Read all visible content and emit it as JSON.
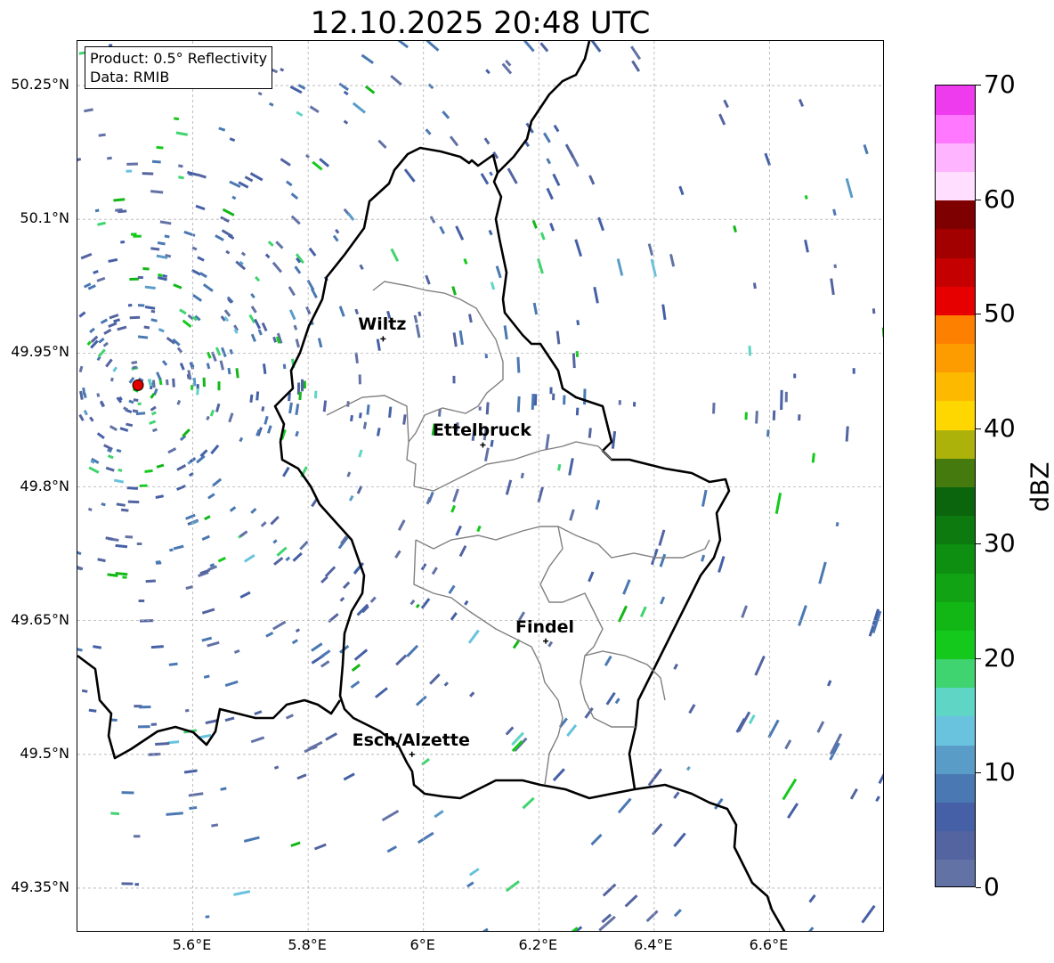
{
  "title": "12.10.2025 20:48 UTC",
  "info": {
    "product": "Product: 0.5° Reflectivity",
    "source": "Data: RMIB"
  },
  "map": {
    "lon_range": [
      5.4,
      6.8
    ],
    "lat_range": [
      49.3,
      50.3
    ],
    "lat_ticks": [
      {
        "value": 50.25,
        "label": "50.25°N"
      },
      {
        "value": 50.1,
        "label": "50.1°N"
      },
      {
        "value": 49.95,
        "label": "49.95°N"
      },
      {
        "value": 49.8,
        "label": "49.8°N"
      },
      {
        "value": 49.65,
        "label": "49.65°N"
      },
      {
        "value": 49.5,
        "label": "49.5°N"
      },
      {
        "value": 49.35,
        "label": "49.35°N"
      }
    ],
    "lon_ticks": [
      {
        "value": 5.6,
        "label": "5.6°E"
      },
      {
        "value": 5.8,
        "label": "5.8°E"
      },
      {
        "value": 6.0,
        "label": "6°E"
      },
      {
        "value": 6.2,
        "label": "6.2°E"
      },
      {
        "value": 6.4,
        "label": "6.4°E"
      },
      {
        "value": 6.6,
        "label": "6.6°E"
      }
    ],
    "radar_site": {
      "lon": 5.505,
      "lat": 49.914
    },
    "cities": [
      {
        "name": "Wiltz",
        "lon": 5.93,
        "lat": 49.966
      },
      {
        "name": "Ettelbruck",
        "lon": 6.103,
        "lat": 49.847
      },
      {
        "name": "Findel",
        "lon": 6.212,
        "lat": 49.627
      },
      {
        "name": "Esch/Alzette",
        "lon": 5.98,
        "lat": 49.5
      }
    ],
    "gridlines": true
  },
  "colorbar": {
    "unit": "dBZ",
    "min": 0,
    "max": 70,
    "step": 2.5,
    "ticks": [
      {
        "value": 0,
        "label": "0"
      },
      {
        "value": 10,
        "label": "10"
      },
      {
        "value": 20,
        "label": "20"
      },
      {
        "value": 30,
        "label": "30"
      },
      {
        "value": 40,
        "label": "40"
      },
      {
        "value": 50,
        "label": "50"
      },
      {
        "value": 60,
        "label": "60"
      },
      {
        "value": 70,
        "label": "70"
      }
    ],
    "colors": [
      "#6272a5",
      "#5364a0",
      "#4560a6",
      "#4a78b2",
      "#5a9cc8",
      "#69c2de",
      "#5ed5c5",
      "#3fd46f",
      "#14c91c",
      "#12b716",
      "#11a313",
      "#0f8f11",
      "#0d7a0f",
      "#0b650c",
      "#457a0e",
      "#adb20b",
      "#fed700",
      "#fdb800",
      "#fd9c00",
      "#fd8000",
      "#e60000",
      "#c40000",
      "#a20000",
      "#7f0000",
      "#ffdeff",
      "#ffb4ff",
      "#ff78ff",
      "#ee3bee"
    ]
  }
}
